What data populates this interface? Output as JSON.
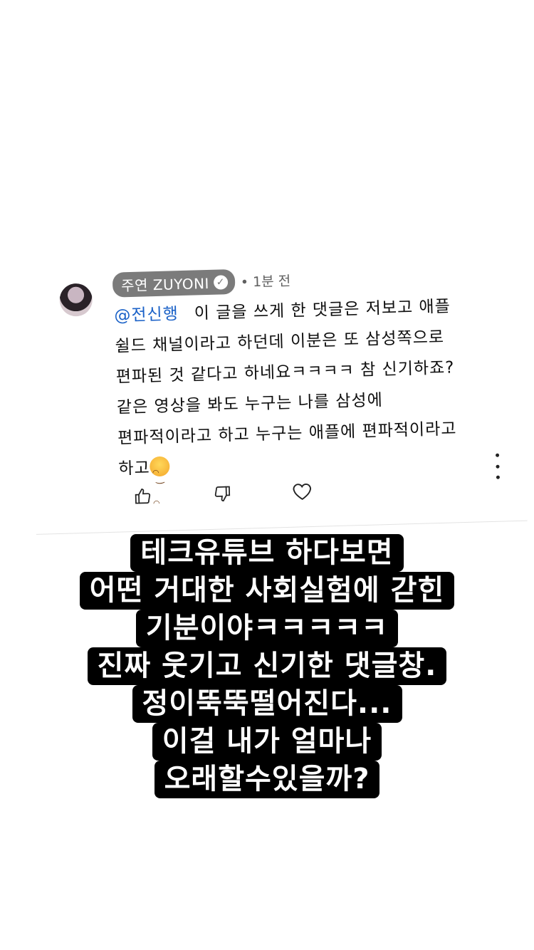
{
  "comment": {
    "author": "주연 ZUYONI",
    "verified_icon": "check-circle-icon",
    "time": "• 1분 전",
    "mention": "@전신행",
    "lines": [
      "이 글을 쓰게 한 댓글은 저보고 애플",
      "쉴드 채널이라고 하던데 이분은 또 삼성쪽으로",
      "편파된 것 같다고 하네요ㅋㅋㅋㅋ 참 신기하죠?",
      "같은 영상을 봐도 누구는 나를 삼성에",
      "편파적이라고 하고 누구는 애플에 편파적이라고",
      "하고"
    ],
    "icons": [
      "thumbs-up-icon",
      "thumbs-down-icon",
      "heart-icon",
      "more-vertical-icon"
    ]
  },
  "story_caption": [
    "테크유튜브 하다보면",
    "어떤 거대한 사회실험에 갇힌",
    "기분이야ㅋㅋㅋㅋㅋ",
    "진짜 웃기고 신기한 댓글창.",
    "정이뚝뚝떨어진다...",
    "이걸 내가 얼마나",
    "오래할수있을까?"
  ]
}
